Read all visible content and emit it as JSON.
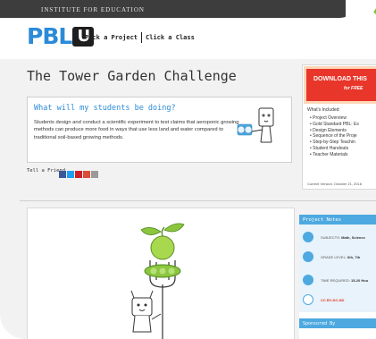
{
  "topbar": {
    "org": "INSTITUTE FOR EDUCATION"
  },
  "header": {
    "logo_text": "PBL",
    "logo_u": "U",
    "nav": [
      {
        "label": "Pick a Project"
      },
      {
        "label": "Click a Class"
      }
    ]
  },
  "page": {
    "title": "The Tower Garden Challenge",
    "what_heading": "What will my students be doing?",
    "what_body": "Students design and conduct a scientific experiment to test claims that aeroponic growing methods can produce more food in ways that use less land and water compared to traditional soil-based growing methods.",
    "tell_friend": "Tell a Friend"
  },
  "share": [
    {
      "icon": "facebook-icon",
      "color": "#3b5998"
    },
    {
      "icon": "twitter-icon",
      "color": "#1da1f2"
    },
    {
      "icon": "pinterest-icon",
      "color": "#cb2027"
    },
    {
      "icon": "google-plus-icon",
      "color": "#dd4b39"
    },
    {
      "icon": "email-icon",
      "color": "#9a9a9a"
    }
  ],
  "download": {
    "line1": "DOWNLOAD THIS",
    "line2": "for FREE",
    "included_label": "What's Included:",
    "items": [
      "Project Overview",
      "Gold Standard PBL: Es",
      "Design Elements",
      "Sequence of the Proje",
      "Step-by-Step Teachin",
      "Student Handouts",
      "Teacher Materials"
    ],
    "version": "Current Version: October 21, 2016"
  },
  "notes": {
    "heading": "Project Notes",
    "subjects_label": "SUBJECTS:",
    "subjects_value": "Math, Science",
    "grade_label": "GRADE LEVEL:",
    "grade_value": "6th, 7th",
    "time_label": "TIME REQUIRED:",
    "time_value": "15-20 Hou",
    "license": "CC BY-NC-ND",
    "sponsored": "Sponsored By"
  },
  "colors": {
    "accent": "#2b8bd8",
    "download_red": "#e8362a",
    "notes_blue": "#4da9e0",
    "brand_green": "#7ac142"
  }
}
